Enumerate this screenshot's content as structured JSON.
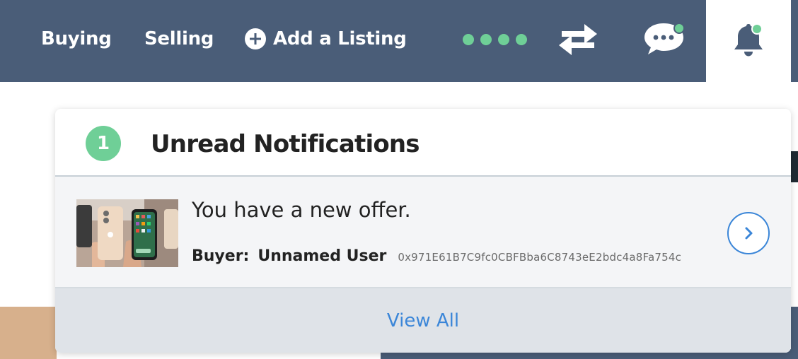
{
  "nav": {
    "buying": "Buying",
    "selling": "Selling",
    "add_listing": "Add a Listing",
    "icons": [
      "plus-circle-icon",
      "transfer-icon",
      "chat-icon",
      "bell-icon"
    ]
  },
  "notifications": {
    "unread_count": "1",
    "title": "Unread Notifications",
    "items": [
      {
        "message": "You have a new offer.",
        "buyer_label": "Buyer:",
        "buyer_name": "Unnamed User",
        "buyer_address": "0x971E61B7C9fc0CBFBba6C8743eE2bdc4a8Fa754c"
      }
    ],
    "view_all": "View All"
  },
  "colors": {
    "navbar": "#4a5d78",
    "accent_green": "#6fcf97",
    "link_blue": "#3b86d8"
  }
}
